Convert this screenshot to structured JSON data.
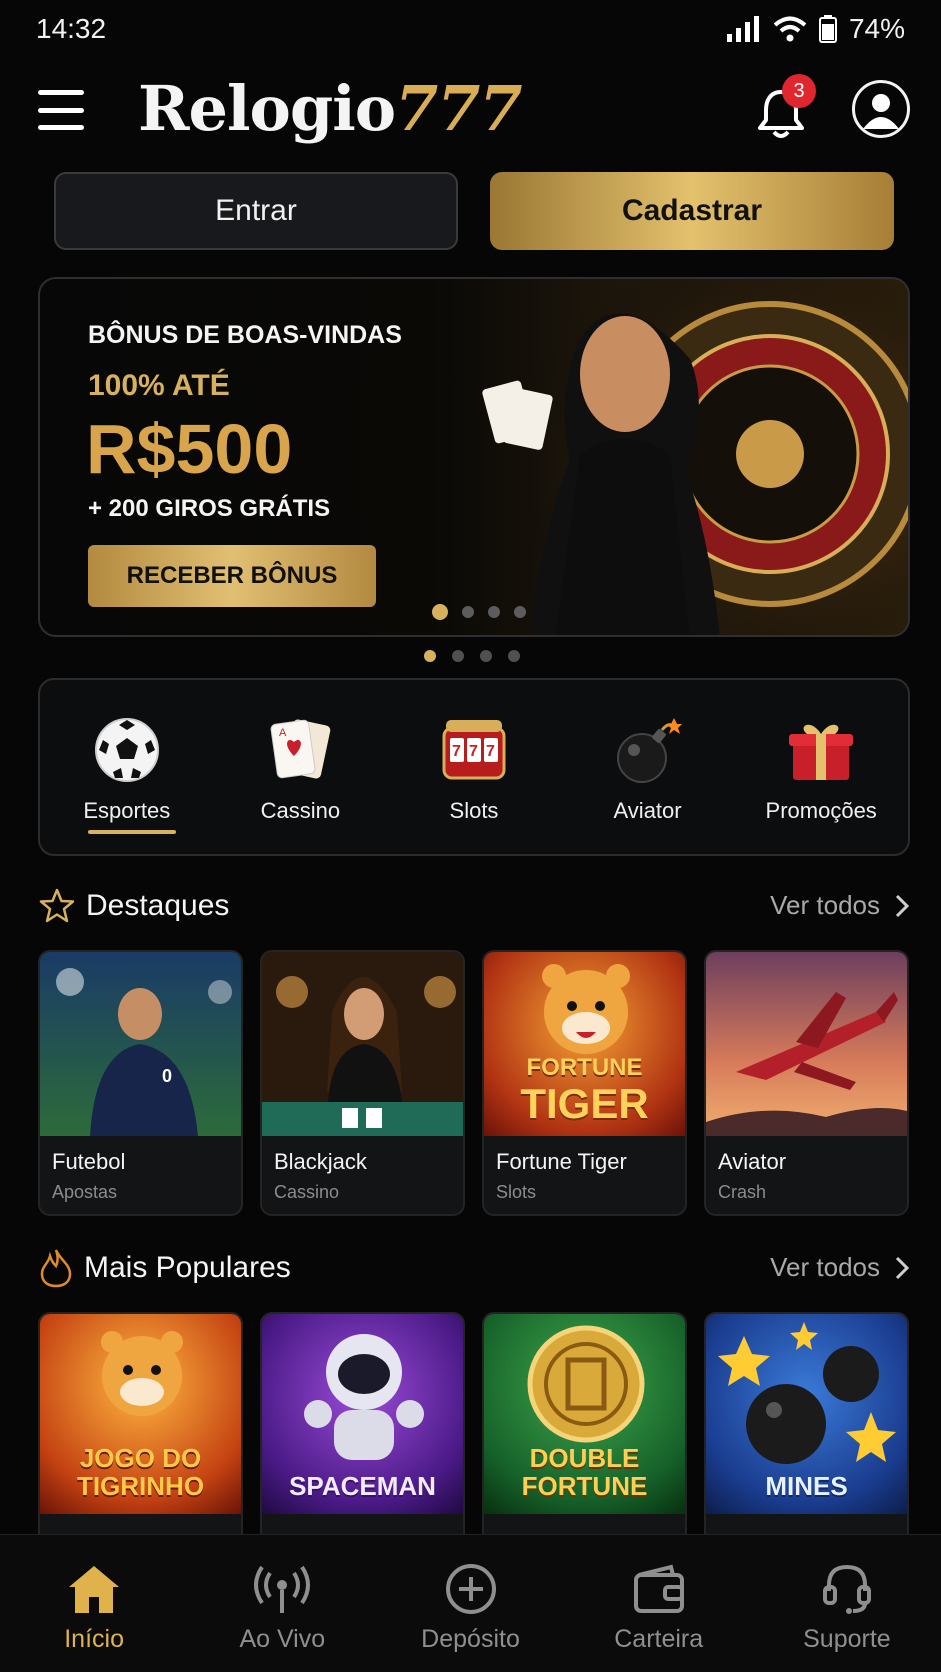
{
  "status_bar": {
    "time": "14:32",
    "battery": "74%"
  },
  "header": {
    "logo_white": "Relogio",
    "logo_gold": "777",
    "notification_count": "3"
  },
  "auth": {
    "login_label": "Entrar",
    "signup_label": "Cadastrar"
  },
  "banner": {
    "subtitle": "BÔNUS DE BOAS-VINDAS",
    "percent": "100% ATÉ",
    "amount": "R$500",
    "extra": "+ 200 GIROS GRÁTIS",
    "cta": "RECEBER BÔNUS"
  },
  "categories": [
    {
      "label": "Esportes",
      "icon": "soccer-ball-icon"
    },
    {
      "label": "Cassino",
      "icon": "cards-icon"
    },
    {
      "label": "Slots",
      "icon": "slot-machine-icon"
    },
    {
      "label": "Aviator",
      "icon": "bomb-icon"
    },
    {
      "label": "Promoções",
      "icon": "gift-icon"
    }
  ],
  "featured": {
    "title": "Destaques",
    "see_all": "Ver todos",
    "items": [
      {
        "name": "Futebol",
        "sub": "Apostas"
      },
      {
        "name": "Blackjack",
        "sub": "Cassino"
      },
      {
        "name": "Fortune Tiger",
        "sub": "Slots",
        "art_line1": "FORTUNE",
        "art_line2": "TIGER"
      },
      {
        "name": "Aviator",
        "sub": "Crash"
      }
    ]
  },
  "popular": {
    "title": "Mais Populares",
    "see_all": "Ver todos",
    "items": [
      {
        "line1": "JOGO DO",
        "line2": "TIGRINHO"
      },
      {
        "line1": "",
        "line2": "SPACEMAN"
      },
      {
        "line1": "DOUBLE",
        "line2": "FORTUNE"
      },
      {
        "line1": "",
        "line2": "MINES"
      }
    ]
  },
  "bottom_nav": [
    {
      "label": "Início",
      "icon": "home-icon",
      "active": true
    },
    {
      "label": "Ao Vivo",
      "icon": "broadcast-icon"
    },
    {
      "label": "Depósito",
      "icon": "plus-circle-icon"
    },
    {
      "label": "Carteira",
      "icon": "wallet-icon"
    },
    {
      "label": "Suporte",
      "icon": "headset-icon"
    }
  ],
  "colors": {
    "accent_gold": "#d8b15f",
    "background": "#060606",
    "badge_red": "#e0262f"
  }
}
